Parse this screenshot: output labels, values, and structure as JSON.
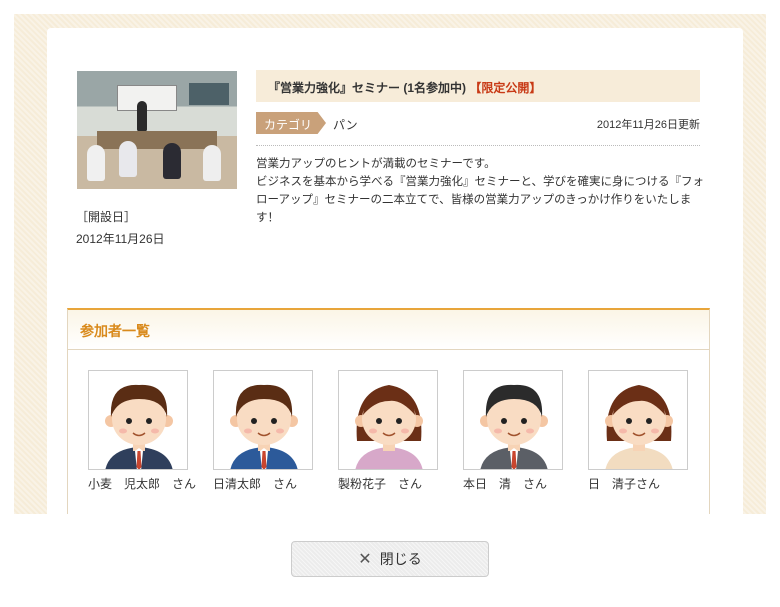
{
  "seminar": {
    "title": "『営業力強化』セミナー (1名参加中)",
    "limited_label": "【限定公開】",
    "category_label": "カテゴリ",
    "category_value": "パン",
    "updated": "2012年11月26日更新",
    "description_lines": [
      "営業力アップのヒントが満載のセミナーです。",
      "ビジネスを基本から学べる『営業力強化』セミナーと、学びを確実に身につける『フォ",
      "ローアップ』セミナーの二本立てで、皆様の営業力アップのきっかけ作りをいたします！"
    ],
    "open_label": "［開設日］",
    "open_date": "2012年11月26日"
  },
  "participants": {
    "heading": "参加者一覧",
    "members": [
      {
        "name": "小麦　児太郎　さん",
        "hair": "#5a2d14",
        "suit": "#2f3f5c",
        "gender": "m"
      },
      {
        "name": "日清太郎　さん",
        "hair": "#5a2d14",
        "suit": "#2c5a9a",
        "gender": "m"
      },
      {
        "name": "製粉花子　さん",
        "hair": "#6b2f16",
        "suit": "#d7a8c9",
        "gender": "f"
      },
      {
        "name": "本日　清　さん",
        "hair": "#2b2b2b",
        "suit": "#5b5f66",
        "gender": "m"
      },
      {
        "name": "日　清子さん",
        "hair": "#6b2f16",
        "suit": "#f2dcc0",
        "gender": "f"
      }
    ]
  },
  "footer": {
    "close_label": "閉じる",
    "close_icon": "close-icon"
  }
}
